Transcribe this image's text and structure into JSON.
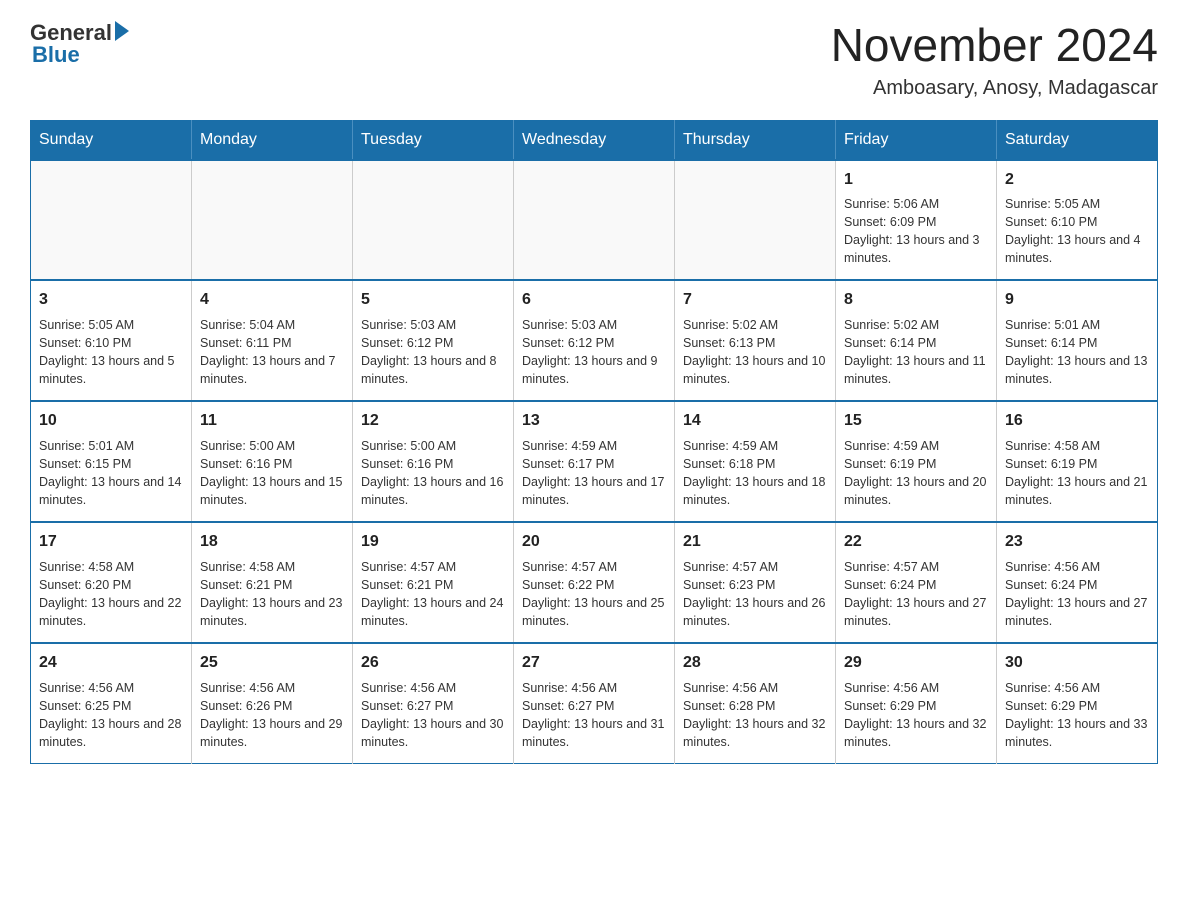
{
  "logo": {
    "general": "General",
    "blue": "Blue"
  },
  "title": "November 2024",
  "location": "Amboasary, Anosy, Madagascar",
  "days_of_week": [
    "Sunday",
    "Monday",
    "Tuesday",
    "Wednesday",
    "Thursday",
    "Friday",
    "Saturday"
  ],
  "weeks": [
    [
      {
        "day": "",
        "info": ""
      },
      {
        "day": "",
        "info": ""
      },
      {
        "day": "",
        "info": ""
      },
      {
        "day": "",
        "info": ""
      },
      {
        "day": "",
        "info": ""
      },
      {
        "day": "1",
        "info": "Sunrise: 5:06 AM\nSunset: 6:09 PM\nDaylight: 13 hours and 3 minutes."
      },
      {
        "day": "2",
        "info": "Sunrise: 5:05 AM\nSunset: 6:10 PM\nDaylight: 13 hours and 4 minutes."
      }
    ],
    [
      {
        "day": "3",
        "info": "Sunrise: 5:05 AM\nSunset: 6:10 PM\nDaylight: 13 hours and 5 minutes."
      },
      {
        "day": "4",
        "info": "Sunrise: 5:04 AM\nSunset: 6:11 PM\nDaylight: 13 hours and 7 minutes."
      },
      {
        "day": "5",
        "info": "Sunrise: 5:03 AM\nSunset: 6:12 PM\nDaylight: 13 hours and 8 minutes."
      },
      {
        "day": "6",
        "info": "Sunrise: 5:03 AM\nSunset: 6:12 PM\nDaylight: 13 hours and 9 minutes."
      },
      {
        "day": "7",
        "info": "Sunrise: 5:02 AM\nSunset: 6:13 PM\nDaylight: 13 hours and 10 minutes."
      },
      {
        "day": "8",
        "info": "Sunrise: 5:02 AM\nSunset: 6:14 PM\nDaylight: 13 hours and 11 minutes."
      },
      {
        "day": "9",
        "info": "Sunrise: 5:01 AM\nSunset: 6:14 PM\nDaylight: 13 hours and 13 minutes."
      }
    ],
    [
      {
        "day": "10",
        "info": "Sunrise: 5:01 AM\nSunset: 6:15 PM\nDaylight: 13 hours and 14 minutes."
      },
      {
        "day": "11",
        "info": "Sunrise: 5:00 AM\nSunset: 6:16 PM\nDaylight: 13 hours and 15 minutes."
      },
      {
        "day": "12",
        "info": "Sunrise: 5:00 AM\nSunset: 6:16 PM\nDaylight: 13 hours and 16 minutes."
      },
      {
        "day": "13",
        "info": "Sunrise: 4:59 AM\nSunset: 6:17 PM\nDaylight: 13 hours and 17 minutes."
      },
      {
        "day": "14",
        "info": "Sunrise: 4:59 AM\nSunset: 6:18 PM\nDaylight: 13 hours and 18 minutes."
      },
      {
        "day": "15",
        "info": "Sunrise: 4:59 AM\nSunset: 6:19 PM\nDaylight: 13 hours and 20 minutes."
      },
      {
        "day": "16",
        "info": "Sunrise: 4:58 AM\nSunset: 6:19 PM\nDaylight: 13 hours and 21 minutes."
      }
    ],
    [
      {
        "day": "17",
        "info": "Sunrise: 4:58 AM\nSunset: 6:20 PM\nDaylight: 13 hours and 22 minutes."
      },
      {
        "day": "18",
        "info": "Sunrise: 4:58 AM\nSunset: 6:21 PM\nDaylight: 13 hours and 23 minutes."
      },
      {
        "day": "19",
        "info": "Sunrise: 4:57 AM\nSunset: 6:21 PM\nDaylight: 13 hours and 24 minutes."
      },
      {
        "day": "20",
        "info": "Sunrise: 4:57 AM\nSunset: 6:22 PM\nDaylight: 13 hours and 25 minutes."
      },
      {
        "day": "21",
        "info": "Sunrise: 4:57 AM\nSunset: 6:23 PM\nDaylight: 13 hours and 26 minutes."
      },
      {
        "day": "22",
        "info": "Sunrise: 4:57 AM\nSunset: 6:24 PM\nDaylight: 13 hours and 27 minutes."
      },
      {
        "day": "23",
        "info": "Sunrise: 4:56 AM\nSunset: 6:24 PM\nDaylight: 13 hours and 27 minutes."
      }
    ],
    [
      {
        "day": "24",
        "info": "Sunrise: 4:56 AM\nSunset: 6:25 PM\nDaylight: 13 hours and 28 minutes."
      },
      {
        "day": "25",
        "info": "Sunrise: 4:56 AM\nSunset: 6:26 PM\nDaylight: 13 hours and 29 minutes."
      },
      {
        "day": "26",
        "info": "Sunrise: 4:56 AM\nSunset: 6:27 PM\nDaylight: 13 hours and 30 minutes."
      },
      {
        "day": "27",
        "info": "Sunrise: 4:56 AM\nSunset: 6:27 PM\nDaylight: 13 hours and 31 minutes."
      },
      {
        "day": "28",
        "info": "Sunrise: 4:56 AM\nSunset: 6:28 PM\nDaylight: 13 hours and 32 minutes."
      },
      {
        "day": "29",
        "info": "Sunrise: 4:56 AM\nSunset: 6:29 PM\nDaylight: 13 hours and 32 minutes."
      },
      {
        "day": "30",
        "info": "Sunrise: 4:56 AM\nSunset: 6:29 PM\nDaylight: 13 hours and 33 minutes."
      }
    ]
  ]
}
